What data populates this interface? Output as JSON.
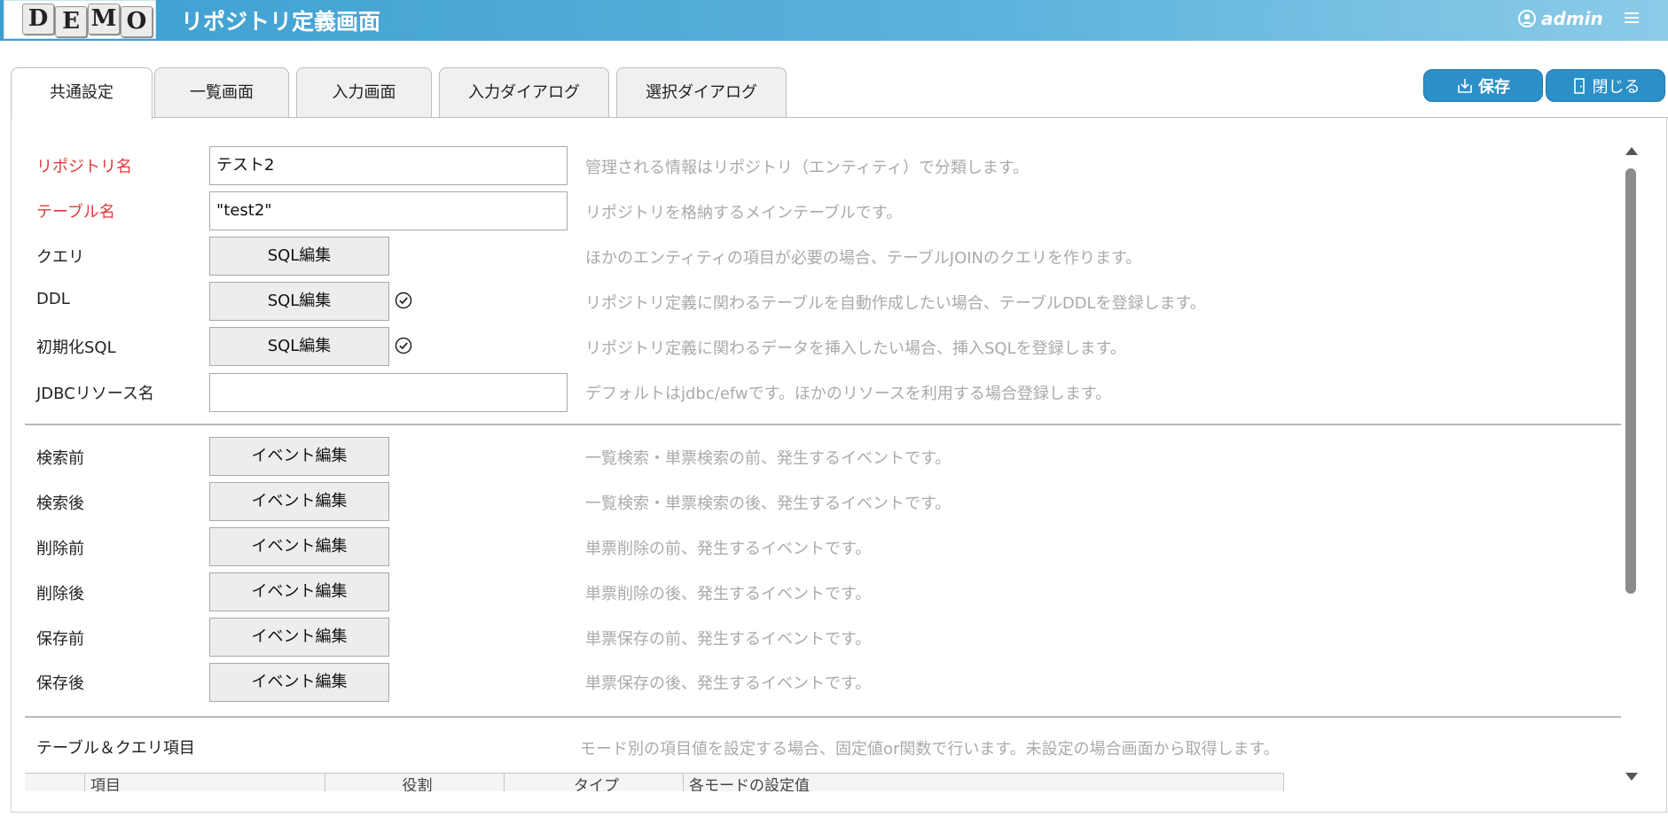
{
  "header": {
    "logo_letters": [
      "D",
      "E",
      "M",
      "O"
    ],
    "title": "リポジトリ定義画面",
    "user": "admin"
  },
  "tabs": [
    "共通設定",
    "一覧画面",
    "入力画面",
    "入力ダイアログ",
    "選択ダイアログ"
  ],
  "actions": {
    "save": "保存",
    "close": "閉じる"
  },
  "form": {
    "repository_name": {
      "label": "リポジトリ名",
      "value": "テスト2",
      "desc": "管理される情報はリポジトリ（エンティティ）で分類します。"
    },
    "table_name": {
      "label": "テーブル名",
      "value": "\"test2\"",
      "desc": "リポジトリを格納するメインテーブルです。"
    },
    "query": {
      "label": "クエリ",
      "button": "SQL編集",
      "desc": "ほかのエンティティの項目が必要の場合、テーブルJOINのクエリを作ります。"
    },
    "ddl": {
      "label": "DDL",
      "button": "SQL編集",
      "desc": "リポジトリ定義に関わるテーブルを自動作成したい場合、テーブルDDLを登録します。"
    },
    "init_sql": {
      "label": "初期化SQL",
      "button": "SQL編集",
      "desc": "リポジトリ定義に関わるデータを挿入したい場合、挿入SQLを登録します。"
    },
    "jdbc": {
      "label": "JDBCリソース名",
      "value": "",
      "desc": "デフォルトはjdbc/efwです。ほかのリソースを利用する場合登録します。"
    }
  },
  "events": [
    {
      "label": "検索前",
      "button": "イベント編集",
      "desc": "一覧検索・単票検索の前、発生するイベントです。"
    },
    {
      "label": "検索後",
      "button": "イベント編集",
      "desc": "一覧検索・単票検索の後、発生するイベントです。"
    },
    {
      "label": "削除前",
      "button": "イベント編集",
      "desc": "単票削除の前、発生するイベントです。"
    },
    {
      "label": "削除後",
      "button": "イベント編集",
      "desc": "単票削除の後、発生するイベントです。"
    },
    {
      "label": "保存前",
      "button": "イベント編集",
      "desc": "単票保存の前、発生するイベントです。"
    },
    {
      "label": "保存後",
      "button": "イベント編集",
      "desc": "単票保存の後、発生するイベントです。"
    }
  ],
  "table_section": {
    "label": "テーブル＆クエリ項目",
    "desc": "モード別の項目値を設定する場合、固定値or関数で行います。未設定の場合画面から取得します。",
    "columns": [
      "",
      "項目",
      "役割",
      "タイプ",
      "各モードの設定值"
    ]
  }
}
